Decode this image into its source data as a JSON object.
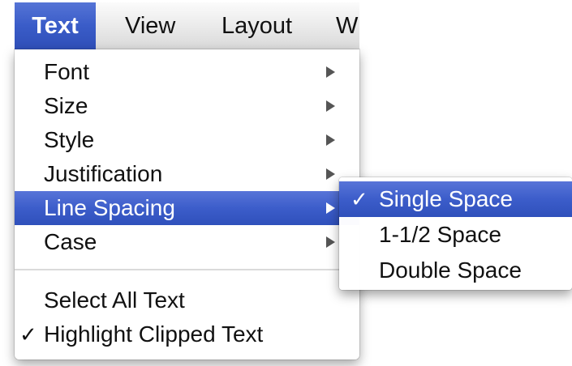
{
  "menubar": {
    "items": [
      {
        "label": "Text",
        "active": true
      },
      {
        "label": "View"
      },
      {
        "label": "Layout"
      },
      {
        "label": "Wir"
      }
    ]
  },
  "text_menu": {
    "items": [
      {
        "label": "Font",
        "has_submenu": true
      },
      {
        "label": "Size",
        "has_submenu": true
      },
      {
        "label": "Style",
        "has_submenu": true
      },
      {
        "label": "Justification",
        "has_submenu": true
      },
      {
        "label": "Line Spacing",
        "has_submenu": true,
        "highlighted": true
      },
      {
        "label": "Case",
        "has_submenu": true
      }
    ],
    "select_all": {
      "label": "Select All Text"
    },
    "highlight_clipped": {
      "label": "Highlight Clipped Text",
      "checked": true,
      "check_mark": "✓"
    }
  },
  "line_spacing_submenu": {
    "items": [
      {
        "label": "Single Space",
        "checked": true,
        "highlighted": true,
        "check_mark": "✓"
      },
      {
        "label": "1-1/2 Space"
      },
      {
        "label": "Double Space"
      }
    ]
  },
  "colors": {
    "highlight": "#3c5dca",
    "text": "#111111",
    "highlight_text": "#ffffff"
  }
}
